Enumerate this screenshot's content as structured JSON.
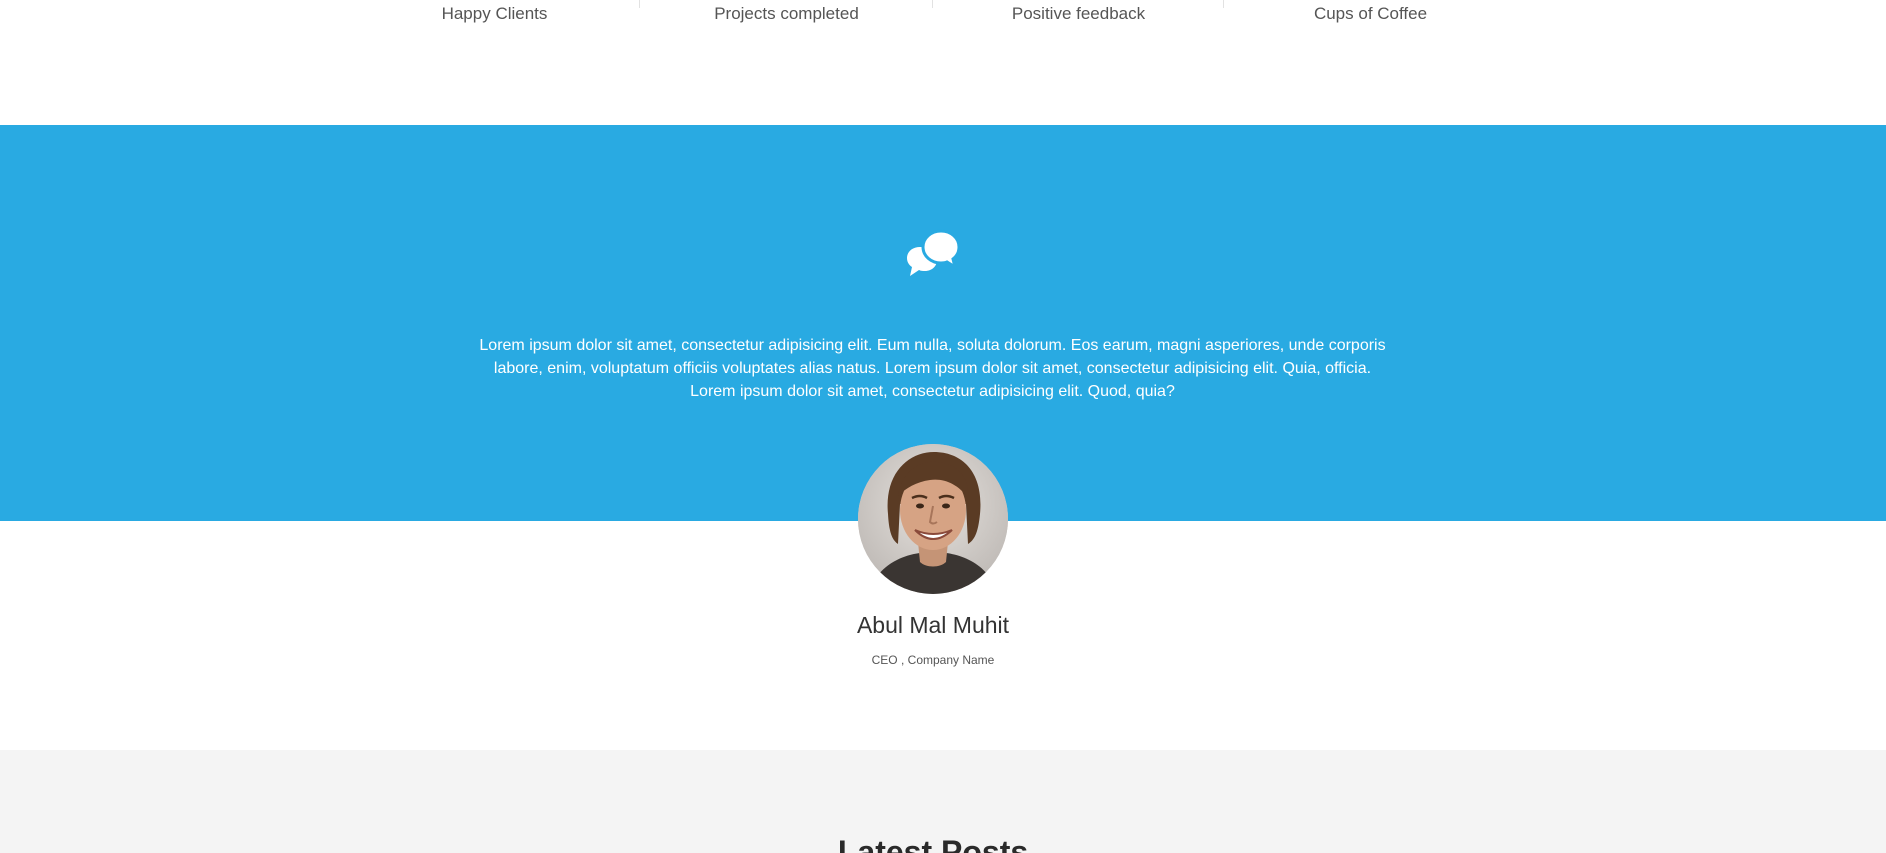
{
  "stats": {
    "items": [
      {
        "label": "Happy Clients"
      },
      {
        "label": "Projects completed"
      },
      {
        "label": "Positive feedback"
      },
      {
        "label": "Cups of Coffee"
      }
    ]
  },
  "testimonial": {
    "icon": "chat-bubbles-icon",
    "text": "Lorem ipsum dolor sit amet, consectetur adipisicing elit. Eum nulla, soluta dolorum. Eos earum, magni asperiores, unde corporis labore, enim, voluptatum officiis voluptates alias natus. Lorem ipsum dolor sit amet, consectetur adipisicing elit. Quia, officia. Lorem ipsum dolor sit amet, consectetur adipisicing elit. Quod, quia?",
    "author_name": "Abul Mal Muhit",
    "author_role": "CEO , Company Name",
    "band_color": "#29aae2"
  },
  "posts": {
    "title": "Latest Posts",
    "background_color": "#f4f4f4"
  }
}
